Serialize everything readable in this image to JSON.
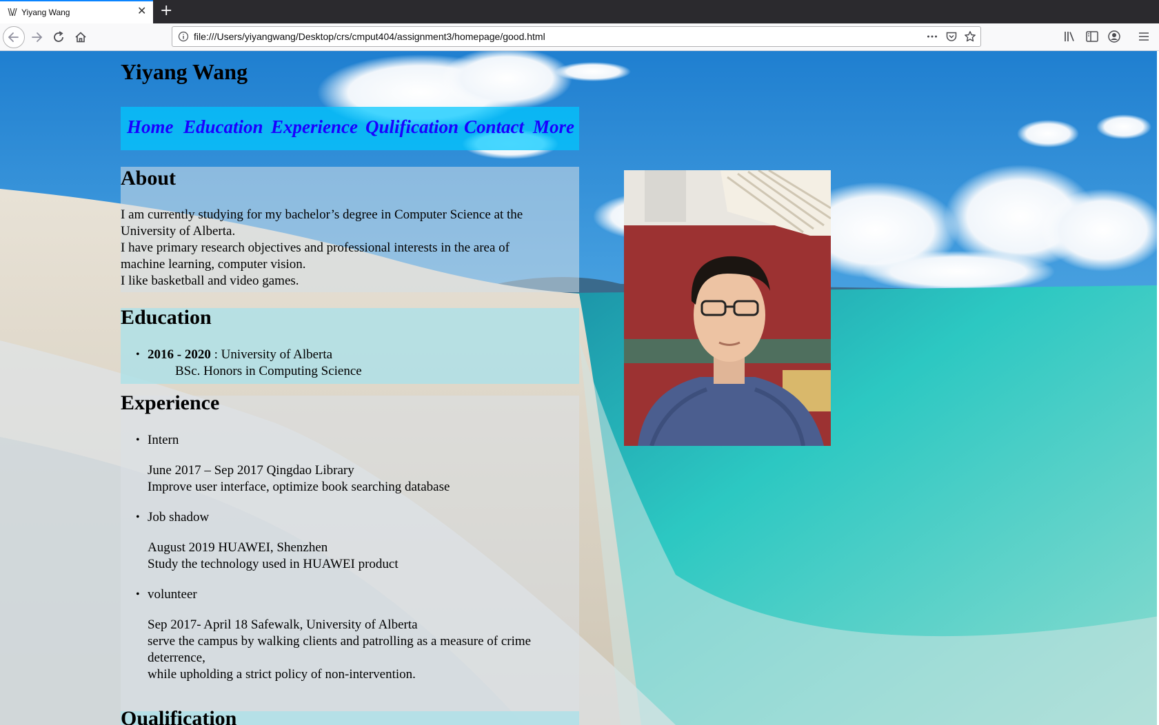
{
  "browser": {
    "tab_title": "Yiyang Wang",
    "url": "file:///Users/yiyangwang/Desktop/crs/cmput404/assignment3/homepage/good.html",
    "accent": "#0a84ff"
  },
  "page": {
    "title": "Yiyang Wang",
    "nav": [
      "Home",
      "Education",
      "Experience",
      "Qulification",
      "Contact",
      "More"
    ],
    "nav_color": "#1a00ff",
    "about": {
      "heading": "About",
      "lines": [
        "I am currently studying for my bachelor’s degree in Computer Science at the",
        "University of Alberta.",
        "I have primary research objectives and professional interests in the area of",
        "machine learning, computer vision.",
        "I like basketball and video games."
      ]
    },
    "education": {
      "heading": "Education",
      "years": "2016 - 2020",
      "school": " : University of Alberta",
      "degree": "BSc. Honors in Computing Science"
    },
    "experience": {
      "heading": "Experience",
      "items": [
        {
          "title": "Intern",
          "details": [
            "June 2017 – Sep 2017 Qingdao Library",
            "Improve user interface, optimize book searching database"
          ]
        },
        {
          "title": "Job shadow",
          "details": [
            "August 2019 HUAWEI, Shenzhen",
            "Study the technology used in HUAWEI product"
          ]
        },
        {
          "title": "volunteer",
          "details": [
            "Sep 2017- April 18 Safewalk, University of Alberta",
            "serve the campus by walking clients and patrolling as a measure of crime",
            "deterrence,",
            "while upholding a strict policy of non-intervention."
          ]
        }
      ]
    },
    "qualification": {
      "heading": "Qualification"
    }
  }
}
